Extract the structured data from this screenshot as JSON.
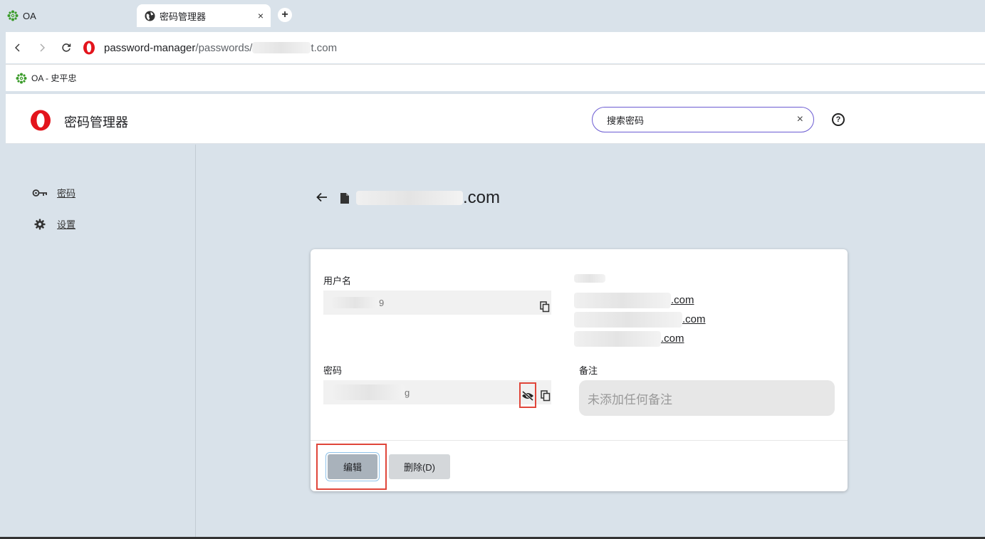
{
  "browser": {
    "tabs": [
      {
        "title": "OA",
        "icon": "gear-flower-icon"
      },
      {
        "title": "密码管理器",
        "icon": "globe-icon",
        "close": "×"
      }
    ],
    "new_tab": "+",
    "url": {
      "host": "password-manager",
      "path": "/passwords/",
      "tail": "t.com"
    },
    "bookmark": {
      "label": "OA - 史平忠",
      "icon": "gear-flower-icon"
    }
  },
  "app": {
    "title": "密码管理器",
    "search": {
      "placeholder": "搜索密码",
      "value": "搜索密码",
      "clear": "×"
    },
    "help": "?"
  },
  "sidebar": {
    "items": [
      {
        "label": "密码",
        "icon": "key-icon"
      },
      {
        "label": "设置",
        "icon": "gear-icon"
      }
    ]
  },
  "detail": {
    "title_tail": ".com",
    "username": {
      "label": "用户名",
      "value_tail": "9"
    },
    "password": {
      "label": "密码",
      "value_tail": "g"
    },
    "sites": [
      ".com",
      ".com",
      ".com"
    ],
    "notes": {
      "label": "备注",
      "placeholder": "未添加任何备注"
    },
    "buttons": {
      "edit": "编辑",
      "delete": "删除(D)"
    }
  },
  "colors": {
    "accent": "#6b5bd2",
    "opera_red": "#e3141c",
    "highlight": "#e0463a",
    "background": "#d9e2ea"
  }
}
